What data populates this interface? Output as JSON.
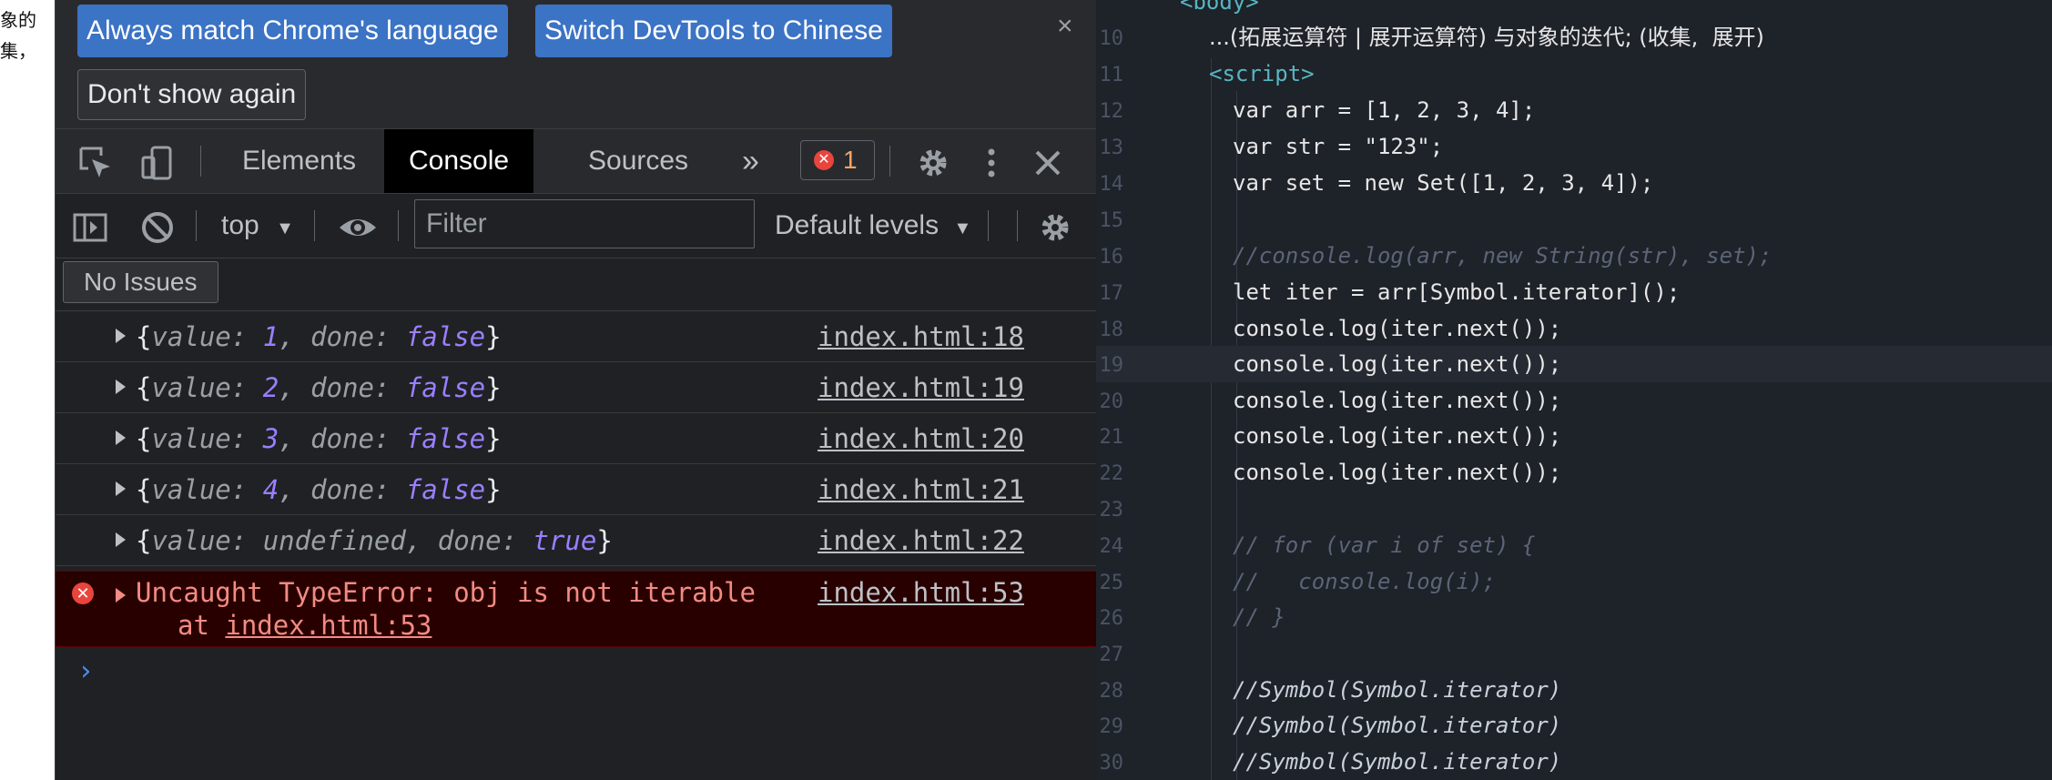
{
  "left_strip": {
    "lines": [
      "象的",
      "集，"
    ]
  },
  "infobar": {
    "btn_match": "Always match Chrome's language",
    "btn_switch": "Switch DevTools to Chinese",
    "btn_dont_show": "Don't show again",
    "close": "×"
  },
  "tabs": {
    "elements": "Elements",
    "console": "Console",
    "sources": "Sources",
    "more": "»",
    "error_count": "1"
  },
  "toolbar": {
    "context": "top",
    "filter_placeholder": "Filter",
    "levels": "Default levels"
  },
  "issues": {
    "label": "No Issues"
  },
  "console": {
    "messages": [
      {
        "value": "1",
        "done": "false",
        "source": "index.html:18"
      },
      {
        "value": "2",
        "done": "false",
        "source": "index.html:19"
      },
      {
        "value": "3",
        "done": "false",
        "source": "index.html:20"
      },
      {
        "value": "4",
        "done": "false",
        "source": "index.html:21"
      },
      {
        "value": "undefined",
        "done": "true",
        "source": "index.html:22"
      }
    ],
    "error": {
      "message": "Uncaught TypeError: obj is not iterable",
      "at_prefix": "at ",
      "at_link": "index.html:53",
      "source": "index.html:53"
    },
    "prompt": "›"
  },
  "editor": {
    "lines": [
      {
        "n": "",
        "text": "<body>"
      },
      {
        "n": "10",
        "text": "...(拓展运算符 | 展开运算符) 与对象的迭代; (收集,  展开)"
      },
      {
        "n": "11",
        "text": "<script>"
      },
      {
        "n": "12",
        "text": "var arr = [1, 2, 3, 4];"
      },
      {
        "n": "13",
        "text": "var str = \"123\";"
      },
      {
        "n": "14",
        "text": "var set = new Set([1, 2, 3, 4]);"
      },
      {
        "n": "15",
        "text": ""
      },
      {
        "n": "16",
        "text": "//console.log(arr, new String(str), set);"
      },
      {
        "n": "17",
        "text": "let iter = arr[Symbol.iterator]();"
      },
      {
        "n": "18",
        "text": "console.log(iter.next());"
      },
      {
        "n": "19",
        "text": "console.log(iter.next());"
      },
      {
        "n": "20",
        "text": "console.log(iter.next());"
      },
      {
        "n": "21",
        "text": "console.log(iter.next());"
      },
      {
        "n": "22",
        "text": "console.log(iter.next());"
      },
      {
        "n": "23",
        "text": ""
      },
      {
        "n": "24",
        "text": "// for (var i of set) {"
      },
      {
        "n": "25",
        "text": "//   console.log(i);"
      },
      {
        "n": "26",
        "text": "// }"
      },
      {
        "n": "27",
        "text": ""
      },
      {
        "n": "28",
        "text": "//Symbol(Symbol.iterator)"
      },
      {
        "n": "29",
        "text": "//Symbol(Symbol.iterator)"
      },
      {
        "n": "30",
        "text": "//Symbol(Symbol.iterator)"
      }
    ]
  },
  "colors": {
    "accent_blue": "#3b73c5",
    "error_red": "#e8453c",
    "error_bg": "#290000",
    "editor_bg": "#1e2229"
  }
}
